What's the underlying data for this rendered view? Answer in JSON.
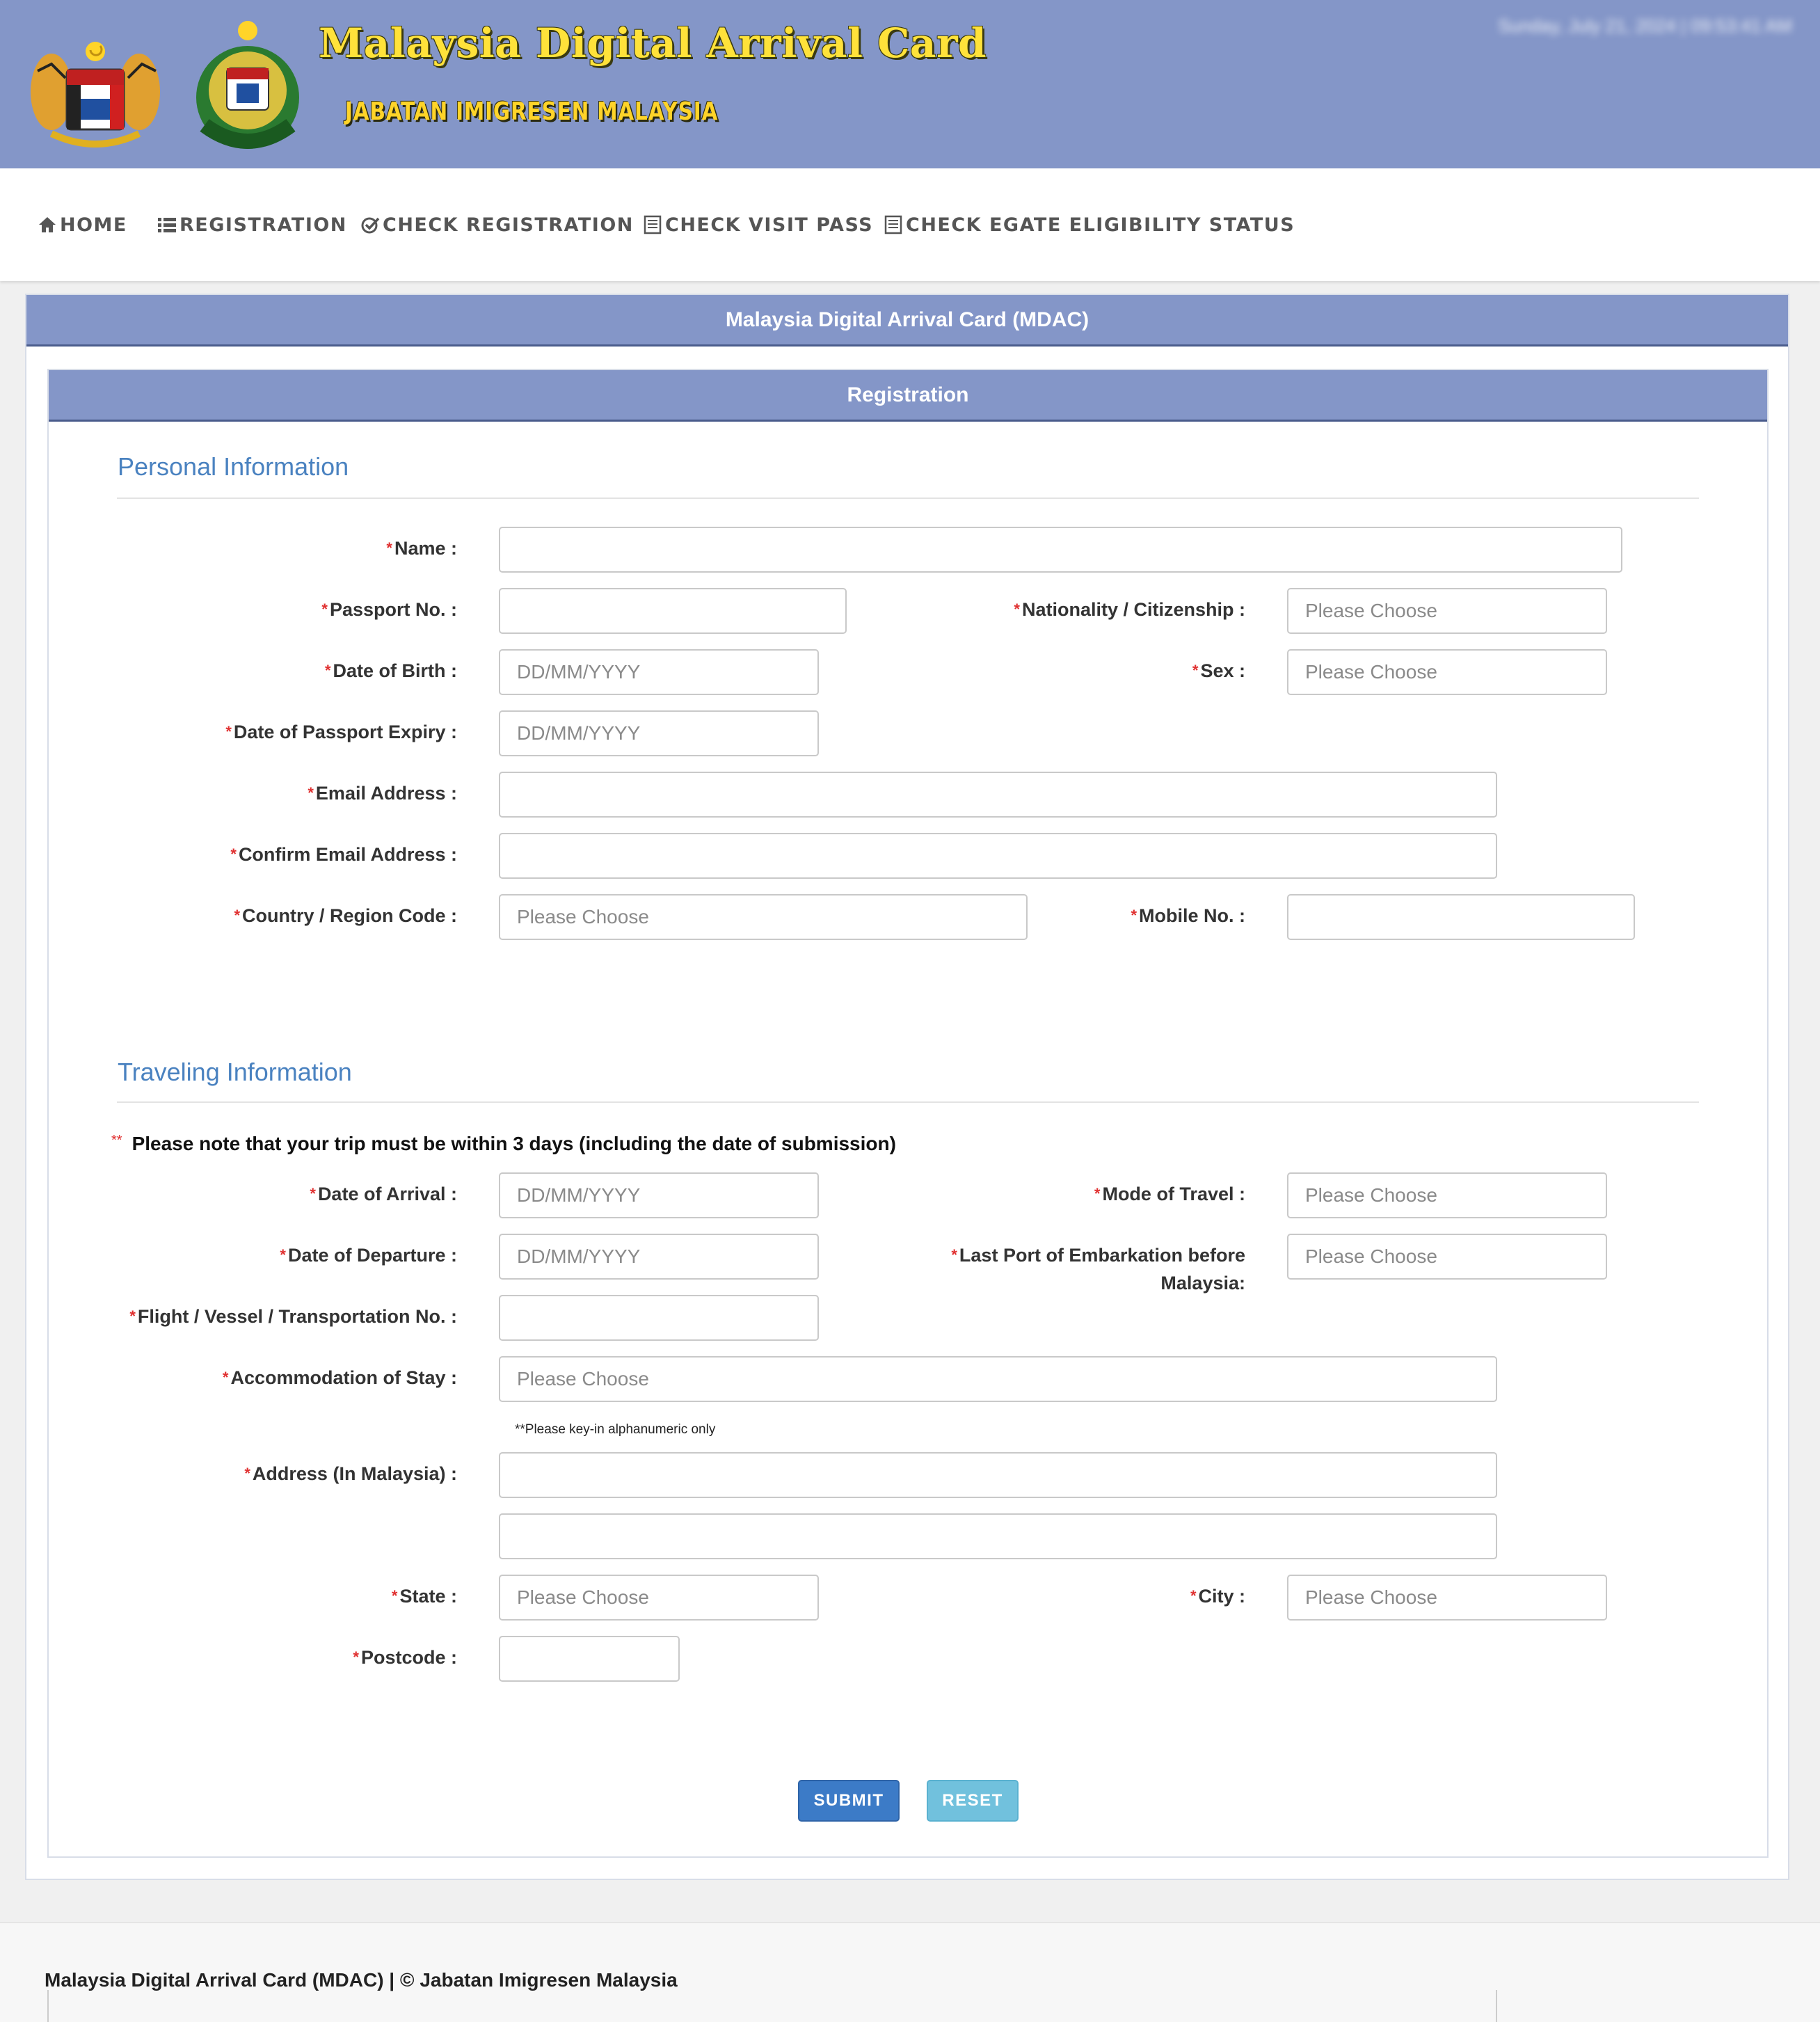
{
  "header": {
    "title": "Malaysia Digital Arrival Card",
    "subtitle": "JABATAN IMIGRESEN MALAYSIA",
    "datetime": "Sunday, July 21, 2024 | 09:53:41 AM",
    "colors": {
      "banner": "#8496c8",
      "title": "#ffe23a"
    }
  },
  "nav": {
    "items": [
      {
        "label": "HOME",
        "icon": "home-icon"
      },
      {
        "label": "REGISTRATION",
        "icon": "list-icon"
      },
      {
        "label": "CHECK REGISTRATION",
        "icon": "check-circle-icon"
      },
      {
        "label": "CHECK VISIT PASS",
        "icon": "document-icon"
      },
      {
        "label": "CHECK EGATE ELIGIBILITY STATUS",
        "icon": "document-icon"
      }
    ]
  },
  "panel": {
    "title": "Malaysia Digital Arrival Card (MDAC)"
  },
  "form": {
    "title": "Registration",
    "personal": {
      "title": "Personal Information",
      "name": {
        "label": "Name :",
        "value": ""
      },
      "passport": {
        "label": "Passport No. :",
        "value": ""
      },
      "nationality": {
        "label": "Nationality / Citizenship :",
        "placeholder": "Please Choose"
      },
      "dob": {
        "label": "Date of Birth :",
        "placeholder": "DD/MM/YYYY"
      },
      "sex": {
        "label": "Sex :",
        "placeholder": "Please Choose"
      },
      "passport_expiry": {
        "label": "Date of Passport Expiry :",
        "placeholder": "DD/MM/YYYY"
      },
      "email": {
        "label": "Email Address :",
        "value": ""
      },
      "confirm_email": {
        "label": "Confirm Email Address :",
        "value": ""
      },
      "country_code": {
        "label": "Country / Region Code :",
        "placeholder": "Please Choose"
      },
      "mobile": {
        "label": "Mobile No. :",
        "value": ""
      }
    },
    "travel": {
      "title": "Traveling Information",
      "note_marker": "**",
      "note": "Please note that your trip must be within 3 days (including the date of submission)",
      "arrival": {
        "label": "Date of Arrival :",
        "placeholder": "DD/MM/YYYY"
      },
      "mode": {
        "label": "Mode of Travel :",
        "placeholder": "Please Choose"
      },
      "departure": {
        "label": "Date of Departure :",
        "placeholder": "DD/MM/YYYY"
      },
      "last_port": {
        "label_line1": "Last Port of Embarkation before",
        "label_line2": "Malaysia:",
        "placeholder": "Please Choose"
      },
      "flight": {
        "label": "Flight / Vessel / Transportation No. :",
        "value": ""
      },
      "accommodation": {
        "label": "Accommodation of Stay :",
        "placeholder": "Please Choose"
      },
      "address_hint": "**Please key-in alphanumeric only",
      "address": {
        "label": "Address (In Malaysia) :",
        "line1": "",
        "line2": ""
      },
      "state": {
        "label": "State :",
        "placeholder": "Please Choose"
      },
      "city": {
        "label": "City :",
        "placeholder": "Please Choose"
      },
      "postcode": {
        "label": "Postcode :",
        "value": ""
      }
    },
    "buttons": {
      "submit": "SUBMIT",
      "reset": "RESET"
    }
  },
  "footer": {
    "text": "Malaysia Digital Arrival Card (MDAC) | © Jabatan Imigresen Malaysia"
  }
}
